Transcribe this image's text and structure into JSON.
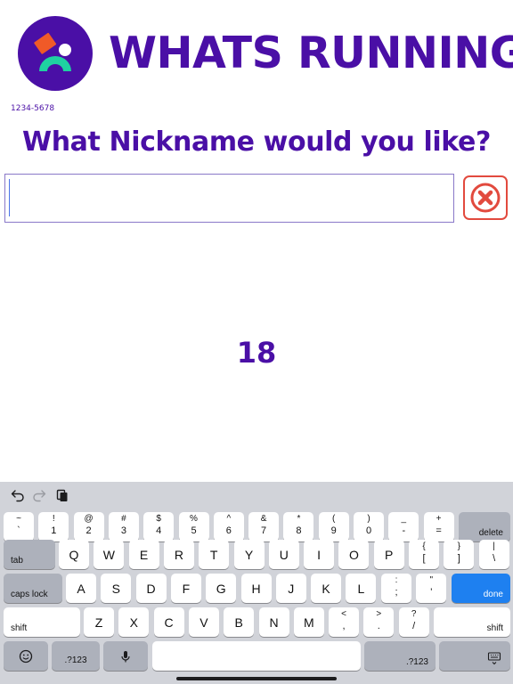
{
  "header": {
    "logo_icon": "runner-logo-icon",
    "title": "WHATS RUNNING",
    "code": "1234-5678"
  },
  "prompt": {
    "question": "What Nickname would you like?",
    "input_value": "",
    "clear_icon": "close-circle-icon"
  },
  "counter": "18",
  "colors": {
    "brand": "#4a0fa6",
    "logo_orange": "#f05a28",
    "logo_green": "#1fd1a1",
    "clear_red": "#e24a3e",
    "done_blue": "#1e80f0",
    "keyboard_bg": "#d1d3d9"
  },
  "keyboard": {
    "toolbar": {
      "undo_icon": "undo-icon",
      "redo_icon": "redo-icon",
      "paste_icon": "paste-icon"
    },
    "number_row": [
      {
        "top": "~",
        "bottom": "`"
      },
      {
        "top": "!",
        "bottom": "1"
      },
      {
        "top": "@",
        "bottom": "2"
      },
      {
        "top": "#",
        "bottom": "3"
      },
      {
        "top": "$",
        "bottom": "4"
      },
      {
        "top": "%",
        "bottom": "5"
      },
      {
        "top": "^",
        "bottom": "6"
      },
      {
        "top": "&",
        "bottom": "7"
      },
      {
        "top": "*",
        "bottom": "8"
      },
      {
        "top": "(",
        "bottom": "9"
      },
      {
        "top": ")",
        "bottom": "0"
      },
      {
        "top": "_",
        "bottom": "-"
      },
      {
        "top": "+",
        "bottom": "="
      }
    ],
    "delete_label": "delete",
    "tab_label": "tab",
    "qwerty": [
      "Q",
      "W",
      "E",
      "R",
      "T",
      "Y",
      "U",
      "I",
      "O",
      "P"
    ],
    "qwerty_punct": [
      {
        "top": "{",
        "bottom": "["
      },
      {
        "top": "}",
        "bottom": "]"
      },
      {
        "top": "|",
        "bottom": "\\"
      }
    ],
    "caps_label": "caps lock",
    "home_row": [
      "A",
      "S",
      "D",
      "F",
      "G",
      "H",
      "J",
      "K",
      "L"
    ],
    "home_punct": [
      {
        "top": ":",
        "bottom": ";"
      },
      {
        "top": "\"",
        "bottom": "'"
      }
    ],
    "done_label": "done",
    "shift_label": "shift",
    "bottom_row": [
      "Z",
      "X",
      "C",
      "V",
      "B",
      "N",
      "M"
    ],
    "bottom_punct": [
      {
        "top": "<",
        "bottom": ","
      },
      {
        "top": ">",
        "bottom": "."
      },
      {
        "top": "?",
        "bottom": "/"
      }
    ],
    "numbers_label": ".?123",
    "emoji_icon": "emoji-icon",
    "mic_icon": "microphone-icon",
    "hide_keyboard_icon": "keyboard-dismiss-icon"
  }
}
